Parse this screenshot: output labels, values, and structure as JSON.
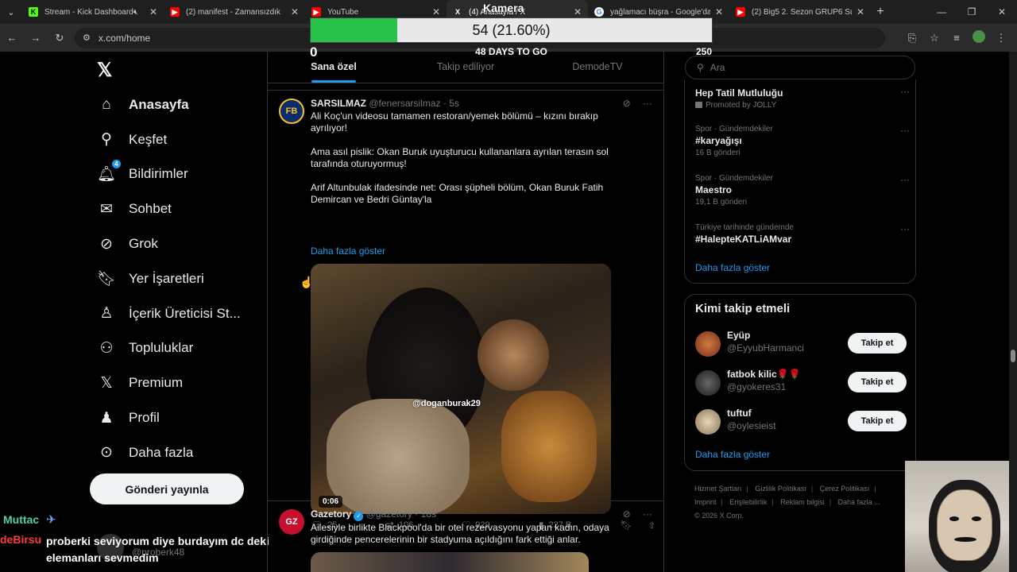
{
  "browser": {
    "tabs": [
      {
        "title": "Stream - Kick Dashboard",
        "icon": "kick-icon",
        "color": "#53fc18",
        "fav_text": "K",
        "muted": true
      },
      {
        "title": "(2) manifest - Zamansızdık",
        "icon": "youtube-icon",
        "color": "#ff0000",
        "fav_text": "▶"
      },
      {
        "title": "YouTube",
        "icon": "youtube-icon",
        "color": "#ff0000",
        "fav_text": "▶"
      },
      {
        "title": "(4) Anasayfa / X",
        "icon": "x-icon",
        "color": "#ffffff",
        "fav_text": "X",
        "active": true
      },
      {
        "title": "yağlamacı büşra - Google'da Ara",
        "icon": "google-icon",
        "color": "#4285f4",
        "fav_text": "G"
      },
      {
        "title": "(2) Big5 2. Sezon GRUP6 Su",
        "icon": "youtube-icon",
        "color": "#ff0000",
        "fav_text": "▶"
      }
    ],
    "url": "x.com/home"
  },
  "overlay": {
    "title": "Kamera",
    "value_text": "54 (21.60%)",
    "progress_fraction": 0.216,
    "min": "0",
    "max": "250",
    "days_text": "48 DAYS TO GO"
  },
  "nav": {
    "items": [
      {
        "label": "Anasayfa",
        "icon": "home-icon"
      },
      {
        "label": "Keşfet",
        "icon": "search-icon"
      },
      {
        "label": "Bildirimler",
        "icon": "bell-icon",
        "badge": "4"
      },
      {
        "label": "Sohbet",
        "icon": "mail-icon"
      },
      {
        "label": "Grok",
        "icon": "grok-icon"
      },
      {
        "label": "Yer İşaretleri",
        "icon": "bookmark-icon"
      },
      {
        "label": "İçerik Üreticisi St...",
        "icon": "creator-icon"
      },
      {
        "label": "Topluluklar",
        "icon": "communities-icon"
      },
      {
        "label": "Premium",
        "icon": "x-premium-icon"
      },
      {
        "label": "Profil",
        "icon": "profile-icon"
      },
      {
        "label": "Daha fazla",
        "icon": "more-icon"
      }
    ],
    "post_button": "Gönderi yayınla"
  },
  "chat": {
    "msg1_user": "Muttac",
    "msg2_user": "deBirsu",
    "msg2_text": "proberki seviyorum diye burdayım dc deki elemanları sevmedim",
    "ghost_handle": "@proberk48"
  },
  "feed": {
    "tabs": [
      "Sana özel",
      "Takip ediliyor",
      "DemodeTV"
    ],
    "tweet1": {
      "name": "SARSILMAZ",
      "handle": "@fenersarsilmaz",
      "time": "· 5s",
      "text": "Ali Koç'un videosu tamamen restoran/yemek bölümü – kızını bırakıp ayrılıyor!\n\nAma asıl pislik: Okan Buruk uyuşturucu kullananlara ayrılan terasın sol tarafında oturuyormuş!\n\nArif Altunbulak ifadesinde net: Orası şüpheli bölüm, Okan Buruk Fatih Demircan ve Bedri Güntay'la",
      "show_more": "Daha fazla göster",
      "watermark": "@doganburak29",
      "duration": "0:06",
      "replies": "25",
      "retweets": "106",
      "likes": "929",
      "views": "227 B"
    },
    "tweet2": {
      "name": "Gazetory",
      "handle": "@gazetory",
      "time": "· 18s",
      "text": "Ailesiyle birlikte Blackpool'da bir otel rezervasyonu yapan kadın, odaya girdiğinde pencerelerinin bir stadyuma açıldığını fark ettiği anlar.",
      "avatar_text": "GZ"
    }
  },
  "right": {
    "search_placeholder": "Ara",
    "trends": [
      {
        "context": "",
        "name": "Hep Tatil Mutluluğu",
        "sub": "Promoted by JOLLY",
        "promoted": true
      },
      {
        "context": "Spor · Gündemdekiler",
        "name": "#karyağışı",
        "sub": "16 B gönderi"
      },
      {
        "context": "Spor · Gündemdekiler",
        "name": "Maestro",
        "sub": "19,1 B gönderi"
      },
      {
        "context": "Türkiye tarihinde gündemde",
        "name": "#HalepteKATLiAMvar",
        "sub": ""
      }
    ],
    "trends_more": "Daha fazla göster",
    "wtf_title": "Kimi takip etmeli",
    "accounts": [
      {
        "name": "Eyüp",
        "handle": "@EyyubHarmanci",
        "button": "Takip et",
        "color": "#b0502a"
      },
      {
        "name": "fatbok kilic🌹🌹",
        "handle": "@gyokeres31",
        "button": "Takip et",
        "color": "#2a2a2a"
      },
      {
        "name": "tuftuf",
        "handle": "@oylesieist",
        "button": "Takip et",
        "color": "#c8b89a"
      }
    ],
    "wtf_more": "Daha fazla göster",
    "footer": [
      "Hizmet Şartları",
      "Gizlilik Politikası",
      "Çerez Politikası",
      "Imprint",
      "Erişilebilirlik",
      "Reklam bilgisi",
      "Daha fazla ...",
      "© 2026 X Corp."
    ]
  }
}
